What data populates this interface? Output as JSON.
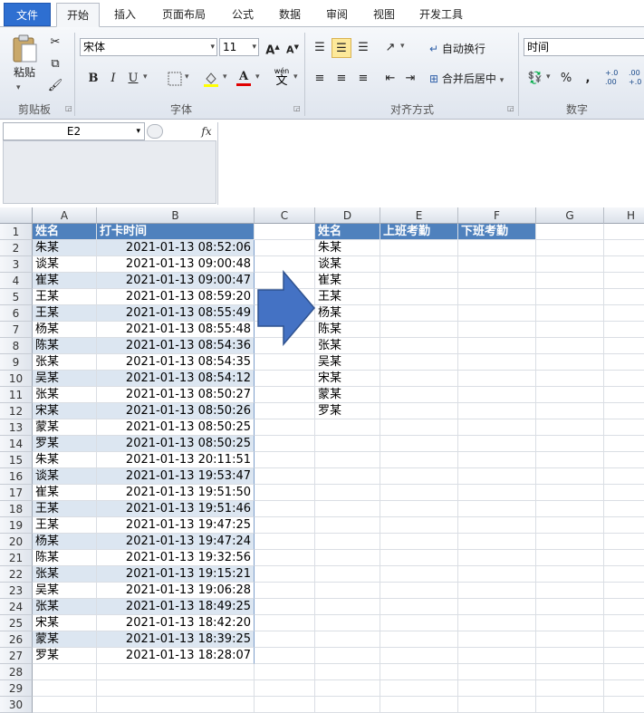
{
  "ribbon": {
    "tabs": [
      "文件",
      "开始",
      "插入",
      "页面布局",
      "公式",
      "数据",
      "审阅",
      "视图",
      "开发工具"
    ],
    "active_tab": "开始",
    "clipboard": {
      "paste_label": "粘贴",
      "group_label": "剪贴板"
    },
    "font": {
      "name": "宋体",
      "size": "11",
      "group_label": "字体",
      "bold": "B",
      "italic": "I",
      "underline": "U",
      "grow": "A",
      "shrink": "A",
      "font_color": "A",
      "phonetic": "wén"
    },
    "alignment": {
      "wrap_text": "自动换行",
      "merge_center": "合并后居中",
      "group_label": "对齐方式"
    },
    "number": {
      "format": "时间",
      "percent": "%",
      "comma": ",",
      "inc_decimal": "+.0\n.00",
      "dec_decimal": ".00\n+.0",
      "group_label": "数字"
    }
  },
  "formula_bar": {
    "name_box": "E2",
    "fx_label": "fx",
    "content": ""
  },
  "columns": [
    "A",
    "B",
    "C",
    "D",
    "E",
    "F",
    "G",
    "H"
  ],
  "rows": [
    "1",
    "2",
    "3",
    "4",
    "5",
    "6",
    "7",
    "8",
    "9",
    "10",
    "11",
    "12",
    "13",
    "14",
    "15",
    "16",
    "17",
    "18",
    "19",
    "20",
    "21",
    "22",
    "23",
    "24",
    "25",
    "26",
    "27",
    "28",
    "29",
    "30"
  ],
  "source_table": {
    "headers": [
      "姓名",
      "打卡时间"
    ],
    "records": [
      [
        "朱某",
        "2021-01-13 08:52:06"
      ],
      [
        "谈某",
        "2021-01-13 09:00:48"
      ],
      [
        "崔某",
        "2021-01-13 09:00:47"
      ],
      [
        "王某",
        "2021-01-13 08:59:20"
      ],
      [
        "王某",
        "2021-01-13 08:55:49"
      ],
      [
        "杨某",
        "2021-01-13 08:55:48"
      ],
      [
        "陈某",
        "2021-01-13 08:54:36"
      ],
      [
        "张某",
        "2021-01-13 08:54:35"
      ],
      [
        "吴某",
        "2021-01-13 08:54:12"
      ],
      [
        "张某",
        "2021-01-13 08:50:27"
      ],
      [
        "宋某",
        "2021-01-13 08:50:26"
      ],
      [
        "蒙某",
        "2021-01-13 08:50:25"
      ],
      [
        "罗某",
        "2021-01-13 08:50:25"
      ],
      [
        "朱某",
        "2021-01-13 20:11:51"
      ],
      [
        "谈某",
        "2021-01-13 19:53:47"
      ],
      [
        "崔某",
        "2021-01-13 19:51:50"
      ],
      [
        "王某",
        "2021-01-13 19:51:46"
      ],
      [
        "王某",
        "2021-01-13 19:47:25"
      ],
      [
        "杨某",
        "2021-01-13 19:47:24"
      ],
      [
        "陈某",
        "2021-01-13 19:32:56"
      ],
      [
        "张某",
        "2021-01-13 19:15:21"
      ],
      [
        "吴某",
        "2021-01-13 19:06:28"
      ],
      [
        "张某",
        "2021-01-13 18:49:25"
      ],
      [
        "宋某",
        "2021-01-13 18:42:20"
      ],
      [
        "蒙某",
        "2021-01-13 18:39:25"
      ],
      [
        "罗某",
        "2021-01-13 18:28:07"
      ]
    ]
  },
  "target_table": {
    "headers": [
      "姓名",
      "上班考勤",
      "下班考勤"
    ],
    "names": [
      "朱某",
      "谈某",
      "崔某",
      "王某",
      "杨某",
      "陈某",
      "张某",
      "吴某",
      "宋某",
      "蒙某",
      "罗某"
    ]
  },
  "arrow_color": "#4472c4",
  "header_fill": "#4f81bd",
  "band_fill": "#dce6f1"
}
